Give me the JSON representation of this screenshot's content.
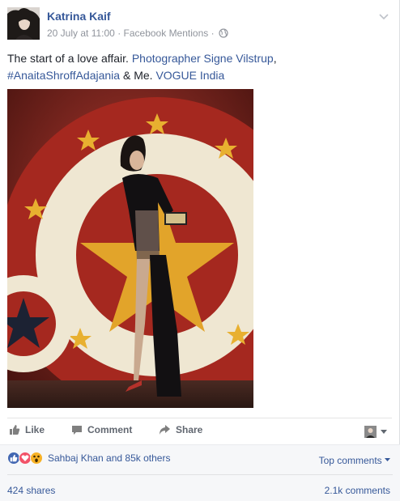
{
  "post": {
    "author": "Katrina Kaif",
    "date": "20 July at 11:00",
    "separator": "·",
    "source": "Facebook Mentions",
    "text_plain_1": "The start of a love affair. ",
    "text_link_1": "Photographer Signe Vilstrup",
    "text_plain_2": ",",
    "text_link_2": "#AnaitaShroffAdajania",
    "text_plain_3": " & Me. ",
    "text_link_3": "VOGUE India"
  },
  "actions": {
    "like": "Like",
    "comment": "Comment",
    "share": "Share"
  },
  "reactions": {
    "icons": [
      "like-reaction-icon",
      "love-reaction-icon",
      "wow-reaction-icon"
    ],
    "summary": "Sahbaj Khan and 85k others",
    "sort_label": "Top comments",
    "shares": "424 shares",
    "comments": "2.1k comments"
  },
  "colors": {
    "link": "#365899",
    "like": "#4267b2",
    "love": "#f25268",
    "wow": "#f7b125"
  }
}
